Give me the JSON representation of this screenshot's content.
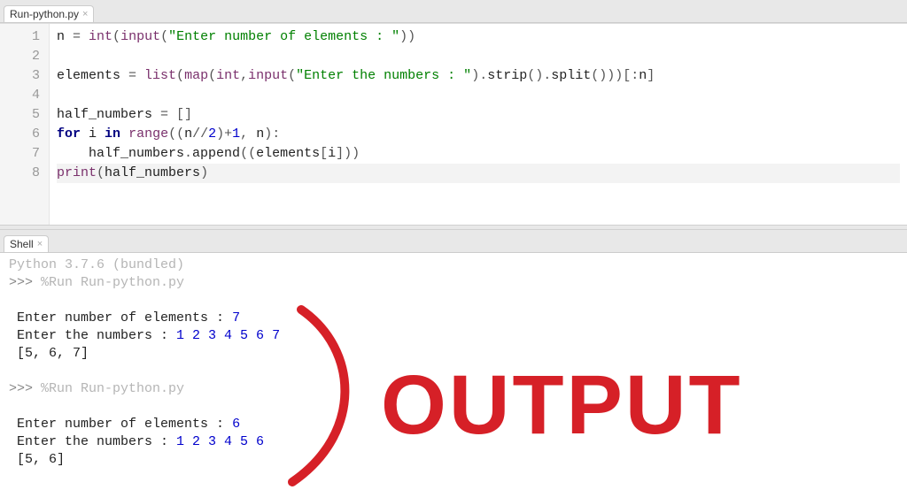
{
  "editor_tab": {
    "label": "Run-python.py"
  },
  "code": [
    {
      "n": 1,
      "tokens": [
        [
          "id",
          "n "
        ],
        [
          "pn",
          "= "
        ],
        [
          "fn",
          "int"
        ],
        [
          "pn",
          "("
        ],
        [
          "fn",
          "input"
        ],
        [
          "pn",
          "("
        ],
        [
          "str",
          "\"Enter number of elements : \""
        ],
        [
          "pn",
          "))"
        ]
      ]
    },
    {
      "n": 2,
      "tokens": []
    },
    {
      "n": 3,
      "tokens": [
        [
          "id",
          "elements "
        ],
        [
          "pn",
          "= "
        ],
        [
          "fn",
          "list"
        ],
        [
          "pn",
          "("
        ],
        [
          "fn",
          "map"
        ],
        [
          "pn",
          "("
        ],
        [
          "fn",
          "int"
        ],
        [
          "pn",
          ","
        ],
        [
          "fn",
          "input"
        ],
        [
          "pn",
          "("
        ],
        [
          "str",
          "\"Enter the numbers : \""
        ],
        [
          "pn",
          ")."
        ],
        [
          "id",
          "strip"
        ],
        [
          "pn",
          "()."
        ],
        [
          "id",
          "split"
        ],
        [
          "pn",
          "()))[:"
        ],
        [
          "id",
          "n"
        ],
        [
          "pn",
          "]"
        ]
      ]
    },
    {
      "n": 4,
      "tokens": []
    },
    {
      "n": 5,
      "tokens": [
        [
          "id",
          "half_numbers "
        ],
        [
          "pn",
          "= []"
        ]
      ]
    },
    {
      "n": 6,
      "tokens": [
        [
          "kw",
          "for"
        ],
        [
          "id",
          " i "
        ],
        [
          "kw",
          "in"
        ],
        [
          "id",
          " "
        ],
        [
          "fn",
          "range"
        ],
        [
          "pn",
          "(("
        ],
        [
          "id",
          "n"
        ],
        [
          "pn",
          "//"
        ],
        [
          "num",
          "2"
        ],
        [
          "pn",
          ")+"
        ],
        [
          "num",
          "1"
        ],
        [
          "pn",
          ", "
        ],
        [
          "id",
          "n"
        ],
        [
          "pn",
          "):"
        ]
      ]
    },
    {
      "n": 7,
      "tokens": [
        [
          "id",
          "    half_numbers"
        ],
        [
          "pn",
          "."
        ],
        [
          "id",
          "append"
        ],
        [
          "pn",
          "(("
        ],
        [
          "id",
          "elements"
        ],
        [
          "pn",
          "["
        ],
        [
          "id",
          "i"
        ],
        [
          "pn",
          "]))"
        ]
      ]
    },
    {
      "n": 8,
      "hl": true,
      "tokens": [
        [
          "fn",
          "print"
        ],
        [
          "pn",
          "("
        ],
        [
          "id",
          "half_numbers"
        ],
        [
          "pn",
          ")"
        ]
      ]
    }
  ],
  "shell_tab": {
    "label": "Shell"
  },
  "shell": {
    "banner": "Python 3.7.6 (bundled)",
    "runs": [
      {
        "cmd": "%Run Run-python.py",
        "io": [
          {
            "prompt": "Enter number of elements : ",
            "input": "7"
          },
          {
            "prompt": "Enter the numbers : ",
            "input": "1 2 3 4 5 6 7"
          }
        ],
        "out": "[5, 6, 7]"
      },
      {
        "cmd": "%Run Run-python.py",
        "io": [
          {
            "prompt": "Enter number of elements : ",
            "input": "6"
          },
          {
            "prompt": "Enter the numbers : ",
            "input": "1 2 3 4 5 6"
          }
        ],
        "out": "[5, 6]"
      }
    ]
  },
  "annotation_text": "OUTPUT"
}
